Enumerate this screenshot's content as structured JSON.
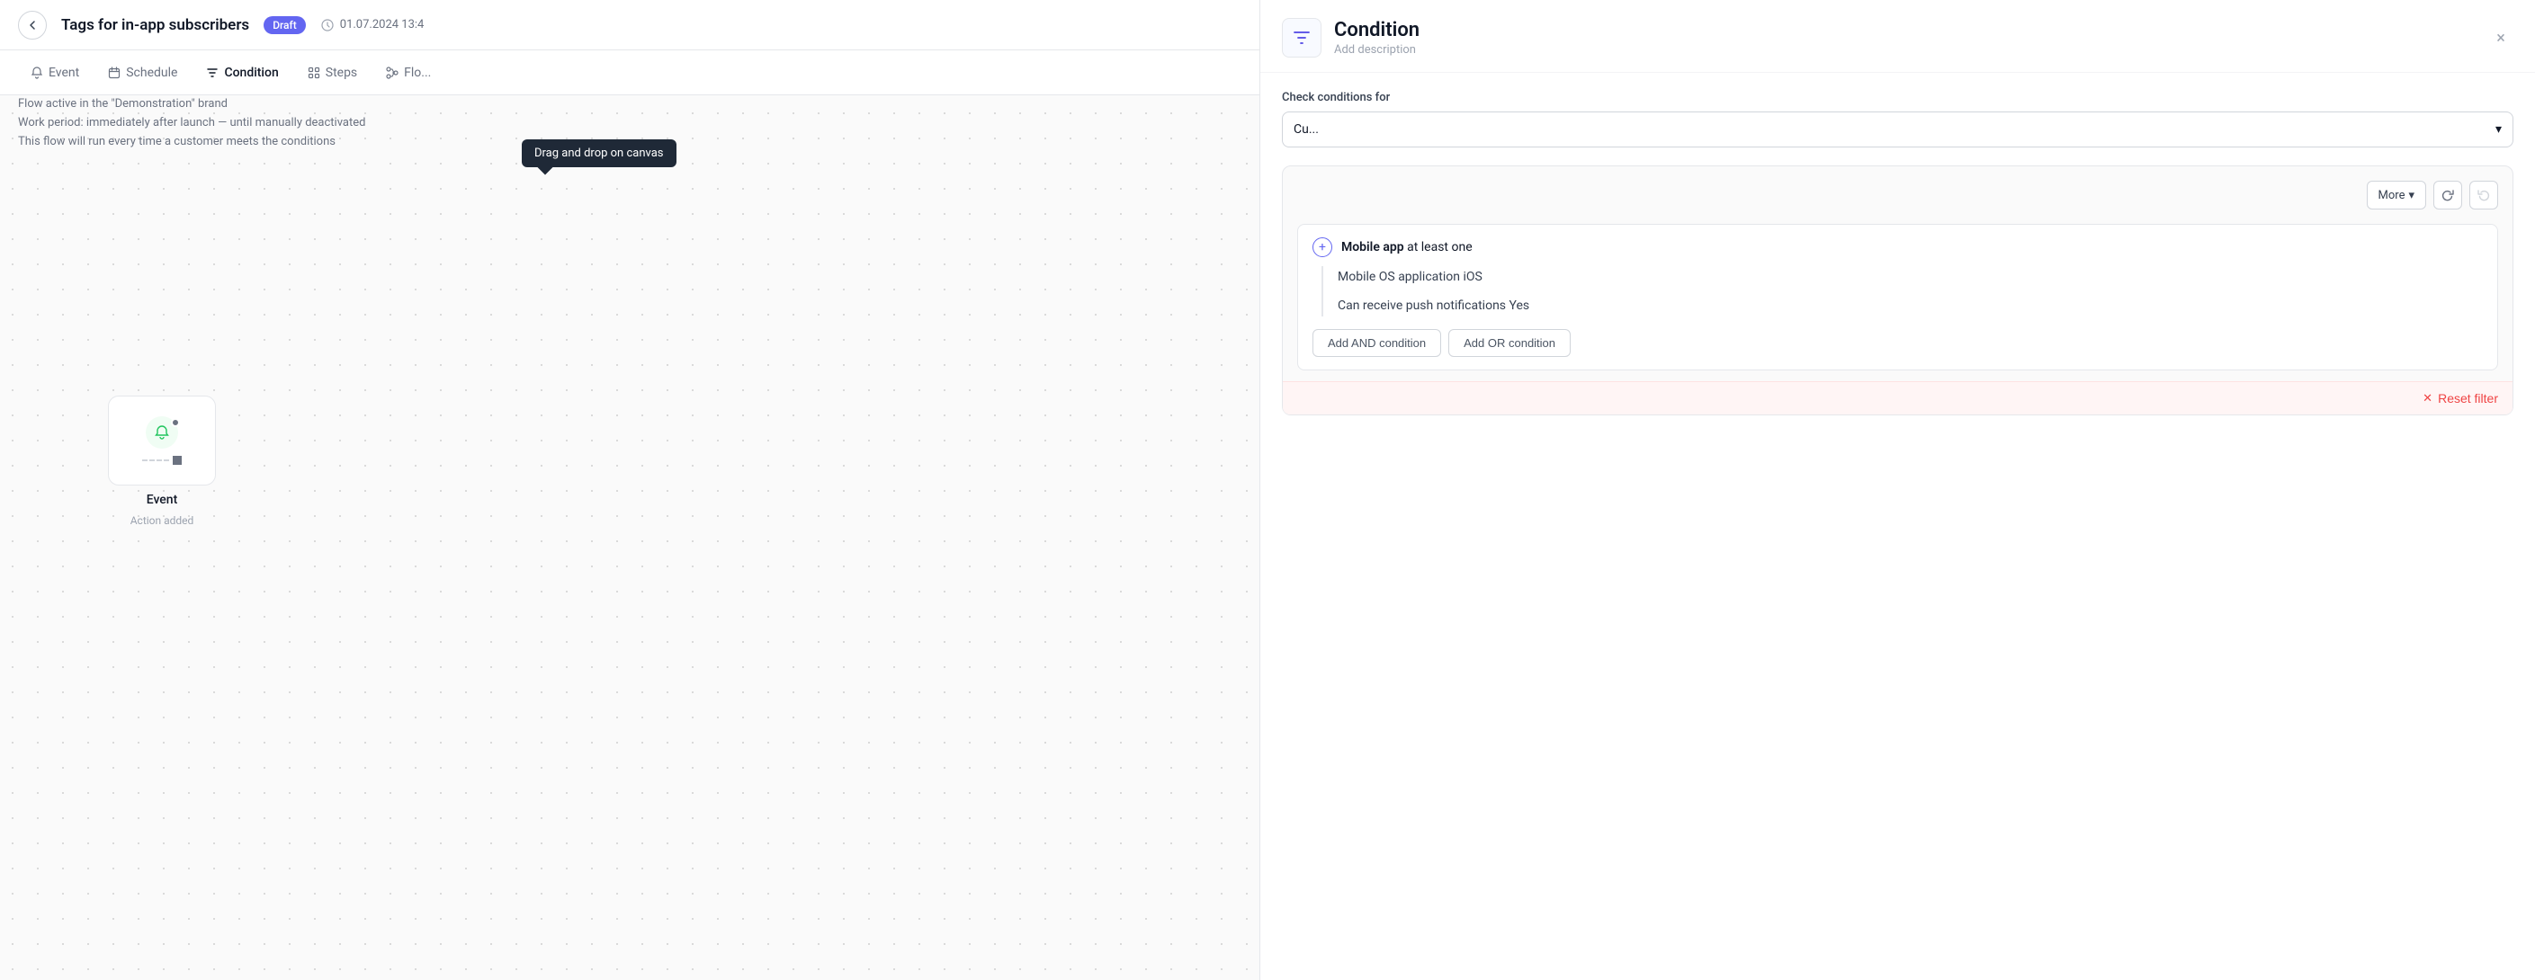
{
  "page": {
    "title": "Tags for in-app subscribers",
    "draft_badge": "Draft",
    "save_status": "01.07.2024 13:4",
    "close_label": "×"
  },
  "tabs": [
    {
      "id": "event",
      "label": "Event",
      "icon": "bell"
    },
    {
      "id": "schedule",
      "label": "Schedule",
      "icon": "calendar"
    },
    {
      "id": "condition",
      "label": "Condition",
      "icon": "filter",
      "active": true
    },
    {
      "id": "steps",
      "label": "Steps",
      "icon": "steps"
    },
    {
      "id": "flow",
      "label": "Flo...",
      "icon": "flow"
    }
  ],
  "info": {
    "line1": "Flow active in the \"Demonstration\" brand",
    "line2": "Work period: immediately after launch — until manually deactivated",
    "line3": "This flow will run every time a customer meets the conditions"
  },
  "canvas": {
    "drag_tooltip": "Drag and drop on canvas",
    "event_node": {
      "label": "Event",
      "sublabel": "Action added"
    }
  },
  "panel": {
    "icon_label": "filter-icon",
    "title": "Condition",
    "subtitle": "Add description",
    "close_label": "×",
    "check_conditions_label": "Check conditions for",
    "dropdown_value": "Cu...",
    "dropdown_arrow": "▾",
    "toolbar": {
      "more_label": "More",
      "more_arrow": "▾",
      "refresh_icon": "↺",
      "reset_icon": "↺"
    },
    "condition_group": {
      "add_icon": "+",
      "title_bold": "Mobile app",
      "title_rest": " at least one",
      "rows": [
        "Mobile OS application iOS",
        "Can receive push notifications Yes"
      ]
    },
    "add_and_label": "Add AND condition",
    "add_or_label": "Add OR condition",
    "reset_filter_icon": "✕",
    "reset_filter_label": "Reset filter"
  }
}
